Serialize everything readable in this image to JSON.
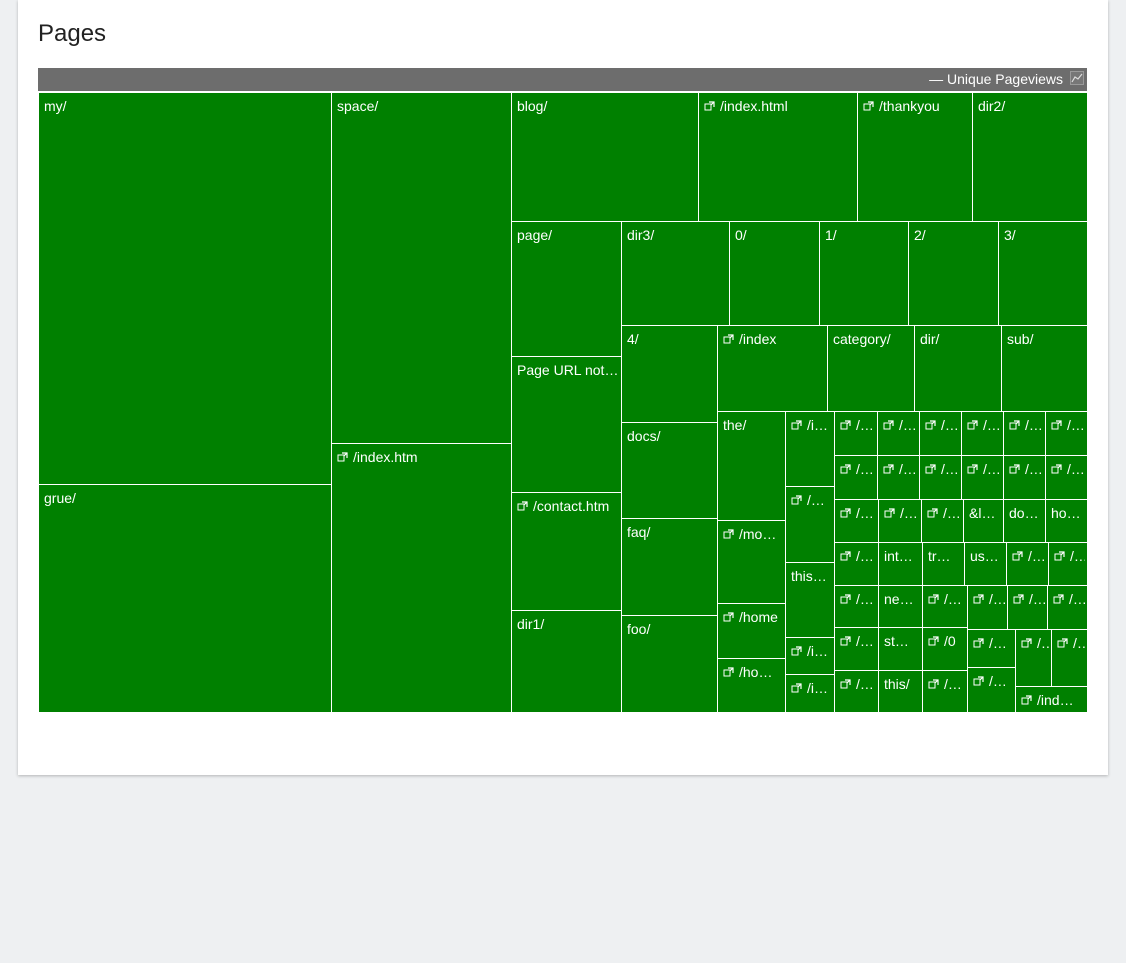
{
  "page": {
    "title": "Pages"
  },
  "legend": {
    "label": "— Unique Pageviews",
    "icon": "line-chart-icon"
  },
  "colors": {
    "cell": "#008000",
    "header": "#6d6d6d",
    "border": "#ffffff",
    "background": "#eef0f2"
  },
  "chart_data": {
    "type": "treemap",
    "metric": "Unique Pageviews",
    "items": [
      {
        "label": "my/",
        "link": false
      },
      {
        "label": "grue/",
        "link": false
      },
      {
        "label": "space/",
        "link": false
      },
      {
        "label": "/index.htm",
        "link": true
      },
      {
        "label": "blog/",
        "link": false
      },
      {
        "label": "/index.html",
        "link": true
      },
      {
        "label": "/thankyou",
        "link": true
      },
      {
        "label": "dir2/",
        "link": false
      },
      {
        "label": "page/",
        "link": false
      },
      {
        "label": "Page URL not defined",
        "link": false
      },
      {
        "label": "/contact.htm",
        "link": true
      },
      {
        "label": "dir1/",
        "link": false
      },
      {
        "label": "dir3/",
        "link": false
      },
      {
        "label": "0/",
        "link": false
      },
      {
        "label": "1/",
        "link": false
      },
      {
        "label": "2/",
        "link": false
      },
      {
        "label": "3/",
        "link": false
      },
      {
        "label": "4/",
        "link": false
      },
      {
        "label": "docs/",
        "link": false
      },
      {
        "label": "faq/",
        "link": false
      },
      {
        "label": "foo/",
        "link": false
      },
      {
        "label": "/index",
        "link": true
      },
      {
        "label": "category/",
        "link": false
      },
      {
        "label": "dir/",
        "link": false
      },
      {
        "label": "sub/",
        "link": false
      },
      {
        "label": "the/",
        "link": false
      },
      {
        "label": "/mo…",
        "link": true
      },
      {
        "label": "/home",
        "link": true
      },
      {
        "label": "/ho…",
        "link": true
      },
      {
        "label": "/i…",
        "link": true
      },
      {
        "label": "/…",
        "link": true
      },
      {
        "label": "this…",
        "link": false
      },
      {
        "label": "/i…",
        "link": true
      },
      {
        "label": "/i…",
        "link": true
      },
      {
        "label": "/…",
        "link": true
      },
      {
        "label": "/…",
        "link": true
      },
      {
        "label": "/…",
        "link": true
      },
      {
        "label": "/…",
        "link": true
      },
      {
        "label": "/…",
        "link": true
      },
      {
        "label": "/…",
        "link": true
      },
      {
        "label": "/…",
        "link": true
      },
      {
        "label": "/…",
        "link": true
      },
      {
        "label": "/…",
        "link": true
      },
      {
        "label": "/…",
        "link": true
      },
      {
        "label": "/…",
        "link": true
      },
      {
        "label": "/…",
        "link": true
      },
      {
        "label": "/…",
        "link": true
      },
      {
        "label": "/…",
        "link": true
      },
      {
        "label": "/…",
        "link": true
      },
      {
        "label": "&l…",
        "link": false
      },
      {
        "label": "do…",
        "link": false
      },
      {
        "label": "ho…",
        "link": false
      },
      {
        "label": "/…",
        "link": true
      },
      {
        "label": "int…",
        "link": false
      },
      {
        "label": "tr…",
        "link": false
      },
      {
        "label": "us…",
        "link": false
      },
      {
        "label": "/…",
        "link": true
      },
      {
        "label": "/…",
        "link": true
      },
      {
        "label": "/…",
        "link": true
      },
      {
        "label": "ne…",
        "link": false
      },
      {
        "label": "/…",
        "link": true
      },
      {
        "label": "/…",
        "link": true
      },
      {
        "label": "/…",
        "link": true
      },
      {
        "label": "/…",
        "link": true
      },
      {
        "label": "/…",
        "link": true
      },
      {
        "label": "st…",
        "link": false
      },
      {
        "label": "/0",
        "link": true
      },
      {
        "label": "/…",
        "link": true
      },
      {
        "label": "/…",
        "link": true
      },
      {
        "label": "/…",
        "link": true
      },
      {
        "label": "/…",
        "link": true
      },
      {
        "label": "this/",
        "link": false
      },
      {
        "label": "/…",
        "link": true
      },
      {
        "label": "/…",
        "link": true
      },
      {
        "label": "/ind…",
        "link": true
      }
    ]
  }
}
